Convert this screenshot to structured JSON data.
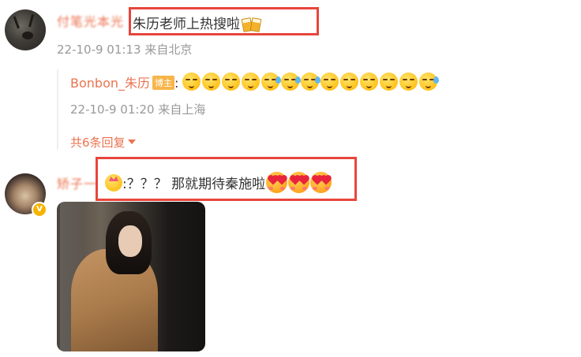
{
  "comment1": {
    "username": "付笔光本光",
    "text": "朱历老师上热搜啦",
    "emoji": "cheers-emoji",
    "timestamp": "22-10-9 01:13",
    "location": "来自北京"
  },
  "reply": {
    "username": "Bonbon_朱历",
    "badge": "博主",
    "colon": ":",
    "emojis": [
      "smirk",
      "smirk",
      "smirk",
      "smirk",
      "sweat",
      "sweat",
      "sweat",
      "smirk",
      "smirk",
      "smirk",
      "smirk",
      "smirk",
      "sweat"
    ],
    "timestamp": "22-10-9 01:20",
    "location": "来自上海",
    "more_link": "共6条回复"
  },
  "comment2": {
    "username": "矫子一",
    "text": ":？？？ 那就期待秦施啦",
    "verified_badge": "V",
    "emojis": [
      "heart-eyes",
      "heart-eyes",
      "heart-eyes"
    ]
  },
  "colors": {
    "accent": "#eb7350",
    "highlight_box": "#e8453c",
    "meta": "#999999"
  }
}
